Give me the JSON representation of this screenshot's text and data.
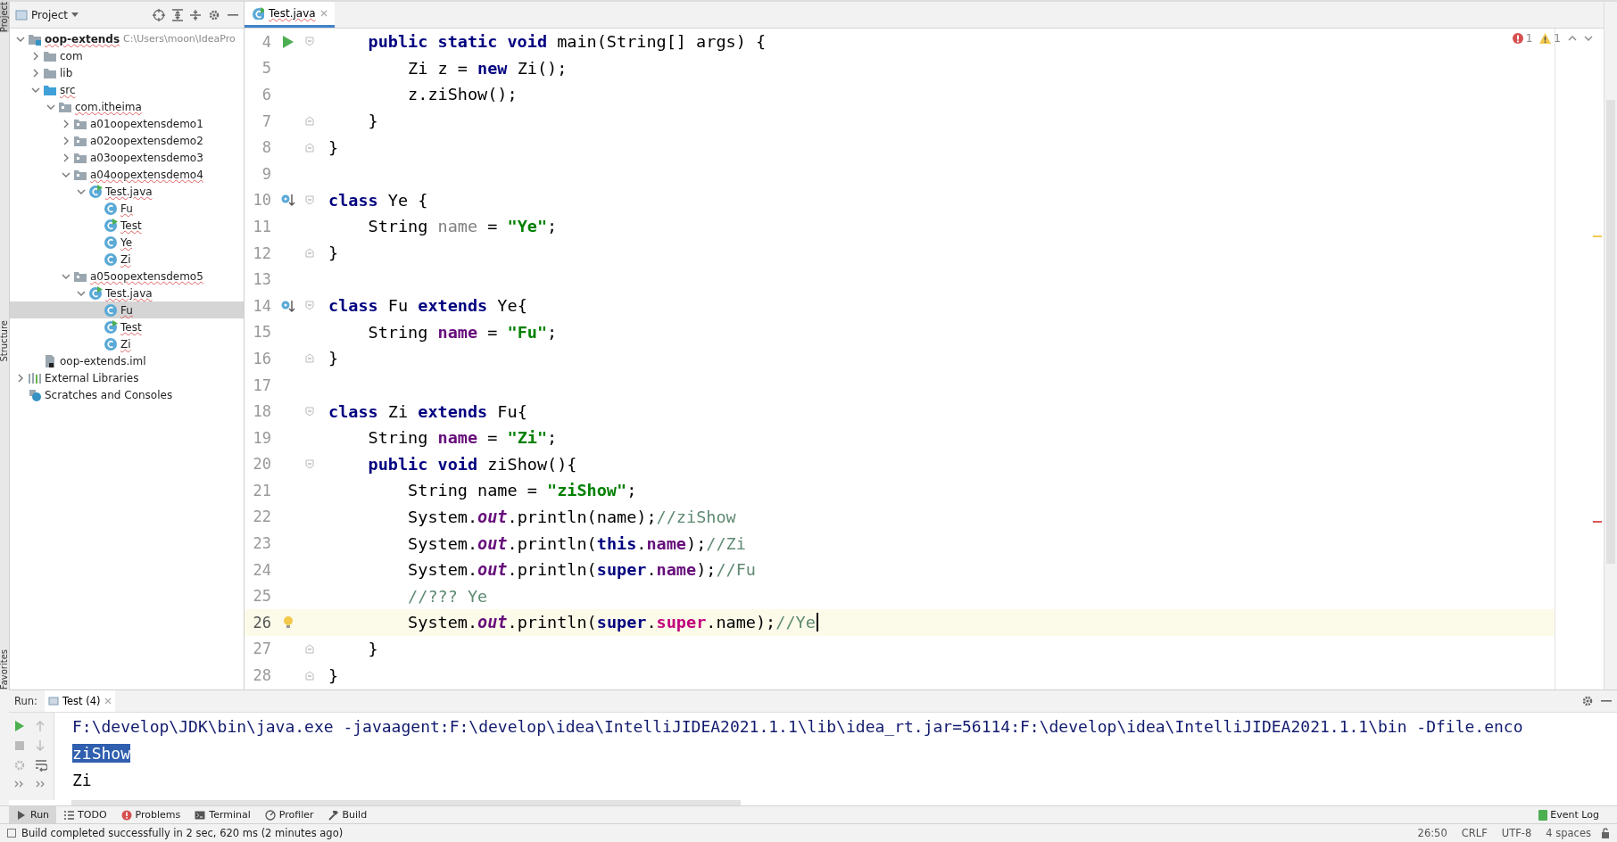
{
  "side_labels": {
    "left_top": "Project",
    "left_mid": "Structure",
    "left_bottom": "Favorites"
  },
  "project_panel": {
    "title": "Project",
    "tree": [
      {
        "label": "oop-extends",
        "path": "C:\\Users\\moon\\IdeaPro",
        "kind": "module",
        "expanded": true,
        "selected": false,
        "children": [
          {
            "label": "com",
            "kind": "folder",
            "expanded": false,
            "selected": false
          },
          {
            "label": "lib",
            "kind": "folder",
            "expanded": false,
            "selected": false
          },
          {
            "label": "src",
            "kind": "source",
            "expanded": true,
            "selected": false,
            "children": [
              {
                "label": "com.itheima",
                "kind": "package",
                "expanded": true,
                "selected": false,
                "children": [
                  {
                    "label": "a01oopextensdemo1",
                    "kind": "package",
                    "expanded": false,
                    "selected": false
                  },
                  {
                    "label": "a02oopextensdemo2",
                    "kind": "package",
                    "expanded": false,
                    "selected": false
                  },
                  {
                    "label": "a03oopextensdemo3",
                    "kind": "package",
                    "expanded": false,
                    "selected": false
                  },
                  {
                    "label": "a04oopextensdemo4",
                    "kind": "package",
                    "expanded": true,
                    "selected": false,
                    "children": [
                      {
                        "label": "Test.java",
                        "kind": "main-class",
                        "expanded": true,
                        "selected": false,
                        "children": [
                          {
                            "label": "Fu",
                            "kind": "class",
                            "selected": false
                          },
                          {
                            "label": "Test",
                            "kind": "main-class",
                            "selected": false
                          },
                          {
                            "label": "Ye",
                            "kind": "class",
                            "selected": false
                          },
                          {
                            "label": "Zi",
                            "kind": "class",
                            "selected": false
                          }
                        ]
                      }
                    ]
                  },
                  {
                    "label": "a05oopextensdemo5",
                    "kind": "package",
                    "expanded": true,
                    "selected": false,
                    "children": [
                      {
                        "label": "Test.java",
                        "kind": "main-class",
                        "expanded": true,
                        "selected": false,
                        "children": [
                          {
                            "label": "Fu",
                            "kind": "class",
                            "selected": true
                          },
                          {
                            "label": "Test",
                            "kind": "main-class",
                            "selected": false
                          },
                          {
                            "label": "Zi",
                            "kind": "class",
                            "selected": false
                          }
                        ]
                      }
                    ]
                  }
                ]
              }
            ]
          },
          {
            "label": "oop-extends.iml",
            "kind": "iml",
            "selected": false
          }
        ]
      },
      {
        "label": "External Libraries",
        "kind": "libraries",
        "expanded": false,
        "selected": false
      },
      {
        "label": "Scratches and Consoles",
        "kind": "scratches",
        "selected": false
      }
    ]
  },
  "editor": {
    "tabs": [
      {
        "label": "Test.java",
        "selected": true
      }
    ],
    "inspections": {
      "errors": "1",
      "warnings": "1"
    },
    "lines": [
      {
        "number": "4",
        "gutter": {
          "kind": "run"
        },
        "fold": {
          "kind": "start"
        },
        "current": false,
        "tokens": [
          {
            "kind": "kw",
            "text": "    public static void"
          },
          {
            "kind": "plain",
            "text": " main(String[] args) {"
          }
        ]
      },
      {
        "number": "5",
        "current": false,
        "tokens": [
          {
            "kind": "plain",
            "text": "        Zi z = "
          },
          {
            "kind": "kw",
            "text": "new"
          },
          {
            "kind": "plain",
            "text": " Zi();"
          }
        ]
      },
      {
        "number": "6",
        "current": false,
        "tokens": [
          {
            "kind": "plain",
            "text": "        z.ziShow();"
          }
        ]
      },
      {
        "number": "7",
        "fold": {
          "kind": "end"
        },
        "current": false,
        "tokens": [
          {
            "kind": "plain",
            "text": "    }"
          }
        ]
      },
      {
        "number": "8",
        "fold": {
          "kind": "end"
        },
        "current": false,
        "tokens": [
          {
            "kind": "plain",
            "text": "}"
          }
        ]
      },
      {
        "number": "9",
        "current": false
      },
      {
        "number": "10",
        "gutter": {
          "kind": "override"
        },
        "fold": {
          "kind": "start"
        },
        "current": false,
        "tokens": [
          {
            "kind": "kw",
            "text": "class"
          },
          {
            "kind": "plain",
            "text": " Ye {"
          }
        ]
      },
      {
        "number": "11",
        "current": false,
        "tokens": [
          {
            "kind": "plain",
            "text": "    String "
          },
          {
            "kind": "unused",
            "text": "name"
          },
          {
            "kind": "plain",
            "text": " = "
          },
          {
            "kind": "str",
            "text": "\"Ye\""
          },
          {
            "kind": "plain",
            "text": ";"
          }
        ]
      },
      {
        "number": "12",
        "fold": {
          "kind": "end"
        },
        "current": false,
        "tokens": [
          {
            "kind": "plain",
            "text": "}"
          }
        ]
      },
      {
        "number": "13",
        "current": false
      },
      {
        "number": "14",
        "gutter": {
          "kind": "override"
        },
        "fold": {
          "kind": "start"
        },
        "current": false,
        "tokens": [
          {
            "kind": "kw",
            "text": "class"
          },
          {
            "kind": "plain",
            "text": " Fu "
          },
          {
            "kind": "kw",
            "text": "extends"
          },
          {
            "kind": "plain",
            "text": " Ye{"
          }
        ]
      },
      {
        "number": "15",
        "current": false,
        "tokens": [
          {
            "kind": "plain",
            "text": "    String "
          },
          {
            "kind": "field",
            "text": "name"
          },
          {
            "kind": "plain",
            "text": " = "
          },
          {
            "kind": "str",
            "text": "\"Fu\""
          },
          {
            "kind": "plain",
            "text": ";"
          }
        ]
      },
      {
        "number": "16",
        "fold": {
          "kind": "end"
        },
        "current": false,
        "tokens": [
          {
            "kind": "plain",
            "text": "}"
          }
        ]
      },
      {
        "number": "17",
        "current": false
      },
      {
        "number": "18",
        "fold": {
          "kind": "start"
        },
        "current": false,
        "tokens": [
          {
            "kind": "kw",
            "text": "class"
          },
          {
            "kind": "plain",
            "text": " Zi "
          },
          {
            "kind": "kw",
            "text": "extends"
          },
          {
            "kind": "plain",
            "text": " Fu{"
          }
        ]
      },
      {
        "number": "19",
        "current": false,
        "tokens": [
          {
            "kind": "plain",
            "text": "    String "
          },
          {
            "kind": "field",
            "text": "name"
          },
          {
            "kind": "plain",
            "text": " = "
          },
          {
            "kind": "str",
            "text": "\"Zi\""
          },
          {
            "kind": "plain",
            "text": ";"
          }
        ]
      },
      {
        "number": "20",
        "fold": {
          "kind": "start"
        },
        "current": false,
        "tokens": [
          {
            "kind": "kw",
            "text": "    public void"
          },
          {
            "kind": "plain",
            "text": " ziShow(){"
          }
        ]
      },
      {
        "number": "21",
        "current": false,
        "tokens": [
          {
            "kind": "plain",
            "text": "        String name = "
          },
          {
            "kind": "str",
            "text": "\"ziShow\""
          },
          {
            "kind": "plain",
            "text": ";"
          }
        ]
      },
      {
        "number": "22",
        "current": false,
        "tokens": [
          {
            "kind": "plain",
            "text": "        System."
          },
          {
            "kind": "static",
            "text": "out"
          },
          {
            "kind": "plain",
            "text": ".println(name);"
          },
          {
            "kind": "comment",
            "text": "//ziShow"
          }
        ]
      },
      {
        "number": "23",
        "current": false,
        "tokens": [
          {
            "kind": "plain",
            "text": "        System."
          },
          {
            "kind": "static",
            "text": "out"
          },
          {
            "kind": "plain",
            "text": ".println("
          },
          {
            "kind": "kw",
            "text": "this"
          },
          {
            "kind": "plain",
            "text": "."
          },
          {
            "kind": "field",
            "text": "name"
          },
          {
            "kind": "plain",
            "text": ");"
          },
          {
            "kind": "comment",
            "text": "//Zi"
          }
        ]
      },
      {
        "number": "24",
        "current": false,
        "tokens": [
          {
            "kind": "plain",
            "text": "        System."
          },
          {
            "kind": "static",
            "text": "out"
          },
          {
            "kind": "plain",
            "text": ".println("
          },
          {
            "kind": "kw",
            "text": "super"
          },
          {
            "kind": "plain",
            "text": "."
          },
          {
            "kind": "field",
            "text": "name"
          },
          {
            "kind": "plain",
            "text": ");"
          },
          {
            "kind": "comment",
            "text": "//Fu"
          }
        ]
      },
      {
        "number": "25",
        "current": false,
        "tokens": [
          {
            "kind": "comment",
            "text": "        //??? Ye"
          }
        ]
      },
      {
        "number": "26",
        "gutter": {
          "kind": "bulb"
        },
        "current": true,
        "tokens": [
          {
            "kind": "plain",
            "text": "        System."
          },
          {
            "kind": "static",
            "text": "out"
          },
          {
            "kind": "plain",
            "text": ".println("
          },
          {
            "kind": "kw",
            "text": "super"
          },
          {
            "kind": "plain",
            "text": "."
          },
          {
            "kind": "error",
            "text": "super"
          },
          {
            "kind": "plain",
            "text": ".name);"
          },
          {
            "kind": "comment",
            "text": "//Ye"
          }
        ]
      },
      {
        "number": "27",
        "fold": {
          "kind": "end"
        },
        "current": false,
        "tokens": [
          {
            "kind": "plain",
            "text": "    }"
          }
        ]
      },
      {
        "number": "28",
        "fold": {
          "kind": "end"
        },
        "current": false,
        "tokens": [
          {
            "kind": "plain",
            "text": "}"
          }
        ]
      }
    ]
  },
  "run_panel": {
    "label": "Run:",
    "tabs": [
      {
        "label": "Test (4)",
        "selected": true
      }
    ],
    "console": [
      {
        "text": "F:\\develop\\JDK\\bin\\java.exe -javaagent:F:\\develop\\idea\\IntelliJIDEA2021.1.1\\lib\\idea_rt.jar=56114:F:\\develop\\idea\\IntelliJIDEA2021.1.1\\bin -Dfile.enco",
        "kind": "command",
        "selected": false
      },
      {
        "text": "ziShow",
        "kind": "output",
        "selected": true
      },
      {
        "text": "Zi",
        "kind": "output",
        "selected": false
      }
    ]
  },
  "tool_tabs": [
    {
      "label": "Run",
      "kind": "run",
      "selected": true
    },
    {
      "label": "TODO",
      "kind": "list",
      "selected": false
    },
    {
      "label": "Problems",
      "kind": "error",
      "selected": false
    },
    {
      "label": "Terminal",
      "kind": "terminal",
      "selected": false
    },
    {
      "label": "Profiler",
      "kind": "profiler",
      "selected": false
    },
    {
      "label": "Build",
      "kind": "hammer",
      "selected": false
    }
  ],
  "event_log": "Event Log",
  "status_bar": {
    "message": "Build completed successfully in 2 sec, 620 ms (2 minutes ago)",
    "items": [
      "26:50",
      "CRLF",
      "UTF-8",
      "4 spaces"
    ]
  }
}
